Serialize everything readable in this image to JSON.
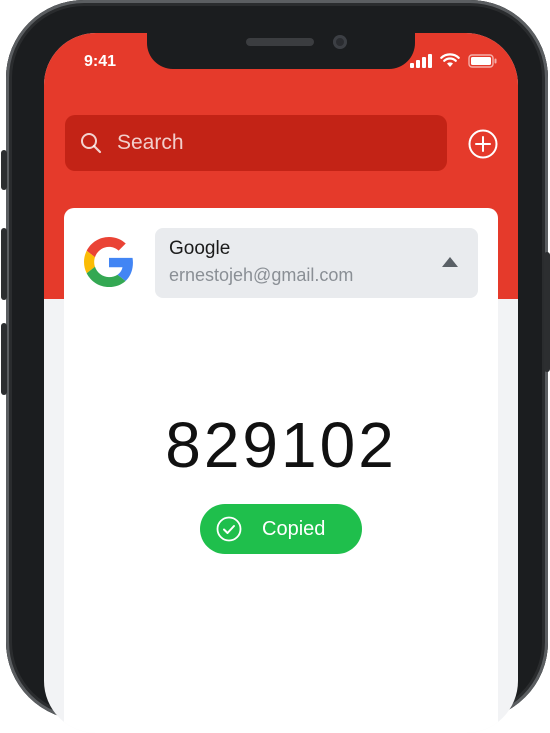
{
  "status_bar": {
    "time": "9:41"
  },
  "search": {
    "label": "Search"
  },
  "account": {
    "provider": "Google",
    "email": "ernestojeh@gmail.com"
  },
  "otp": {
    "code": "829102",
    "status": "Copied"
  },
  "colors": {
    "header": "#e53a2b",
    "search_bg": "#c32316",
    "copied": "#1fbf4c"
  }
}
